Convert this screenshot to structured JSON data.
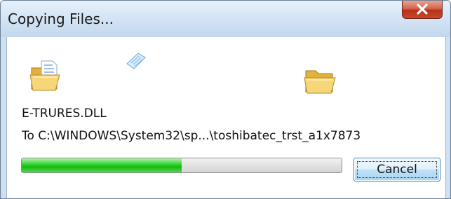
{
  "window": {
    "title": "Copying Files..."
  },
  "icons": {
    "source_folder": "folder-open-icon",
    "flying_document": "document-icon",
    "target_folder": "folder-open-icon",
    "close": "close-icon"
  },
  "operation": {
    "file_name": "E-TRURES.DLL",
    "destination": "To C:\\WINDOWS\\System32\\sp...\\toshibatec_trst_a1x7873"
  },
  "progress": {
    "fraction": 0.5
  },
  "buttons": {
    "cancel_label": "Cancel"
  },
  "colors": {
    "progress_green": "#2cc92a",
    "close_red": "#c9472b"
  }
}
